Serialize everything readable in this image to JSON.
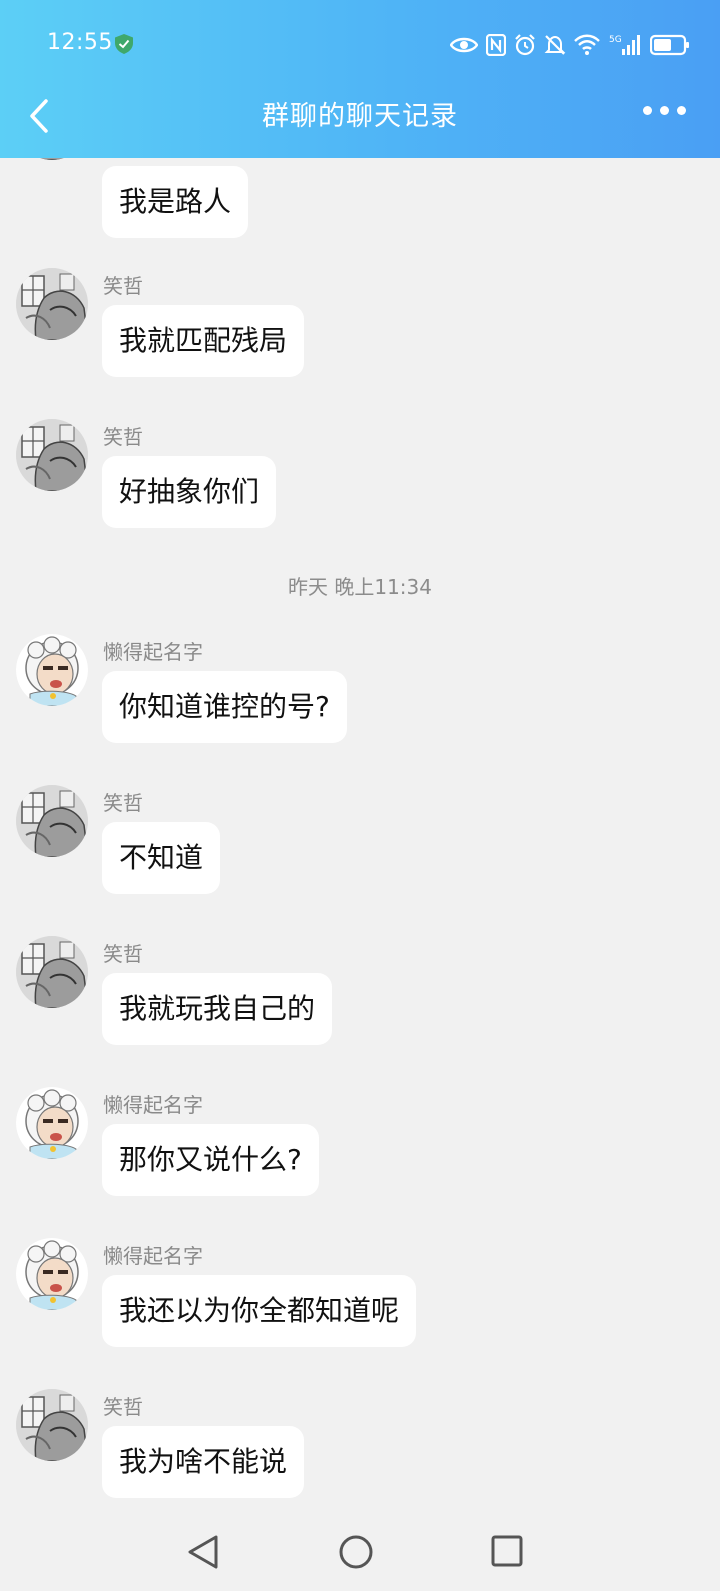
{
  "status": {
    "time": "12:55",
    "network": "5G"
  },
  "header": {
    "title": "群聊的聊天记录"
  },
  "messages": [
    {
      "sender": "",
      "text": "我是路人",
      "avatar": "sketch-avatar"
    },
    {
      "sender": "笑哲",
      "text": "我就匹配残局",
      "avatar": "sketch-avatar"
    },
    {
      "sender": "笑哲",
      "text": "好抽象你们",
      "avatar": "sketch-avatar"
    },
    {
      "sender": "懒得起名字",
      "text": "你知道谁控的号?",
      "avatar": "sheep-avatar"
    },
    {
      "sender": "笑哲",
      "text": "不知道",
      "avatar": "sketch-avatar"
    },
    {
      "sender": "笑哲",
      "text": "我就玩我自己的",
      "avatar": "sketch-avatar"
    },
    {
      "sender": "懒得起名字",
      "text": "那你又说什么?",
      "avatar": "sheep-avatar"
    },
    {
      "sender": "懒得起名字",
      "text": "我还以为你全都知道呢",
      "avatar": "sheep-avatar"
    },
    {
      "sender": "笑哲",
      "text": "我为啥不能说",
      "avatar": "sketch-avatar"
    }
  ],
  "timestamp": "昨天 晚上11:34",
  "colors": {
    "header_start": "#5ccff6",
    "header_end": "#4a9ff4",
    "background": "#f1f1f1",
    "bubble": "#ffffff"
  }
}
